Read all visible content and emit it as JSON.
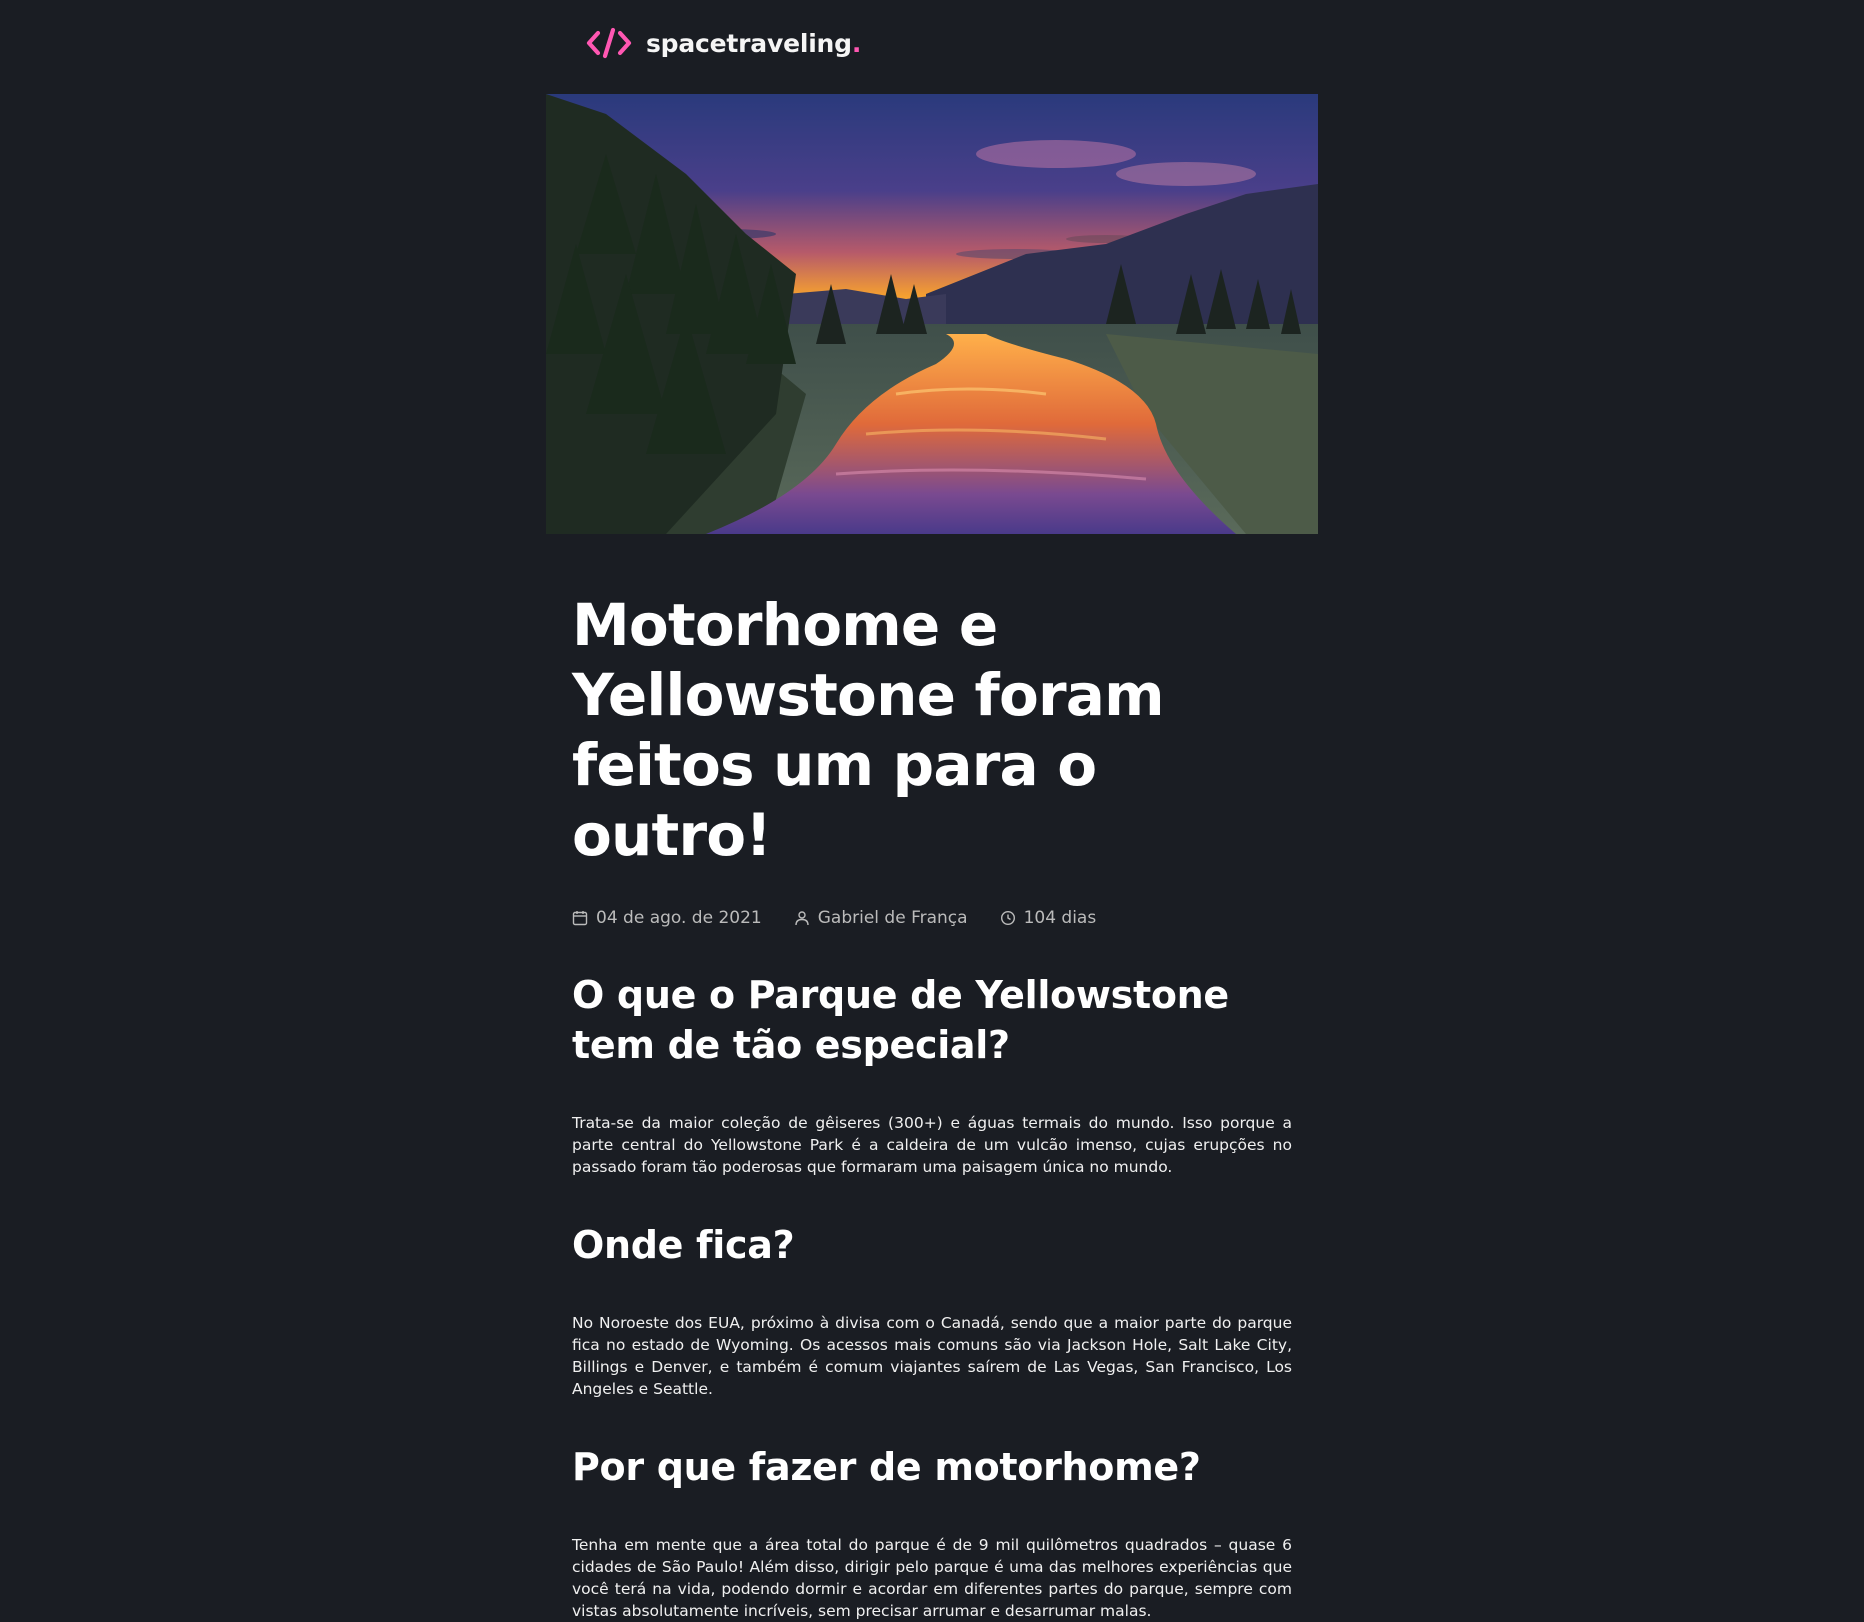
{
  "header": {
    "logo_icon": "code-brackets-icon",
    "logo_text": "spacetraveling",
    "logo_dot": "."
  },
  "banner": {
    "image_description_icon": "landscape-image"
  },
  "article": {
    "title": "Motorhome e Yellowstone foram feitos um para o outro!",
    "meta": {
      "date": "04 de ago. de 2021",
      "author": "Gabriel de França",
      "reading_time": "104 dias"
    },
    "sections": [
      {
        "heading": "O que o Parque de Yellowstone tem de tão especial?",
        "body": "Trata-se da maior coleção de gêiseres (300+) e águas termais do mundo. Isso porque a parte central do Yellowstone Park é a caldeira de um vulcão imenso, cujas erupções no passado foram tão poderosas que formaram uma paisagem única no mundo."
      },
      {
        "heading": "Onde fica?",
        "body": "No Noroeste dos EUA, próximo à divisa com o Canadá, sendo que a maior parte do parque fica no estado de Wyoming. Os acessos mais comuns são via Jackson Hole, Salt Lake City, Billings e Denver, e também é comum viajantes saírem de Las Vegas, San Francisco, Los Angeles e Seattle."
      },
      {
        "heading": "Por que fazer de motorhome?",
        "body": "Tenha em mente que a área total do parque é de 9 mil quilômetros quadrados – quase 6 cidades de São Paulo! Além disso, dirigir pelo parque é uma das melhores experiências que você terá na vida, podendo dormir e acordar em diferentes partes do parque, sempre com vistas absolutamente incríveis, sem precisar arrumar e desarrumar malas."
      }
    ]
  },
  "colors": {
    "background": "#1a1d23",
    "accent": "#ff57b2",
    "text": "#ffffff",
    "muted": "#bbbbbb"
  }
}
